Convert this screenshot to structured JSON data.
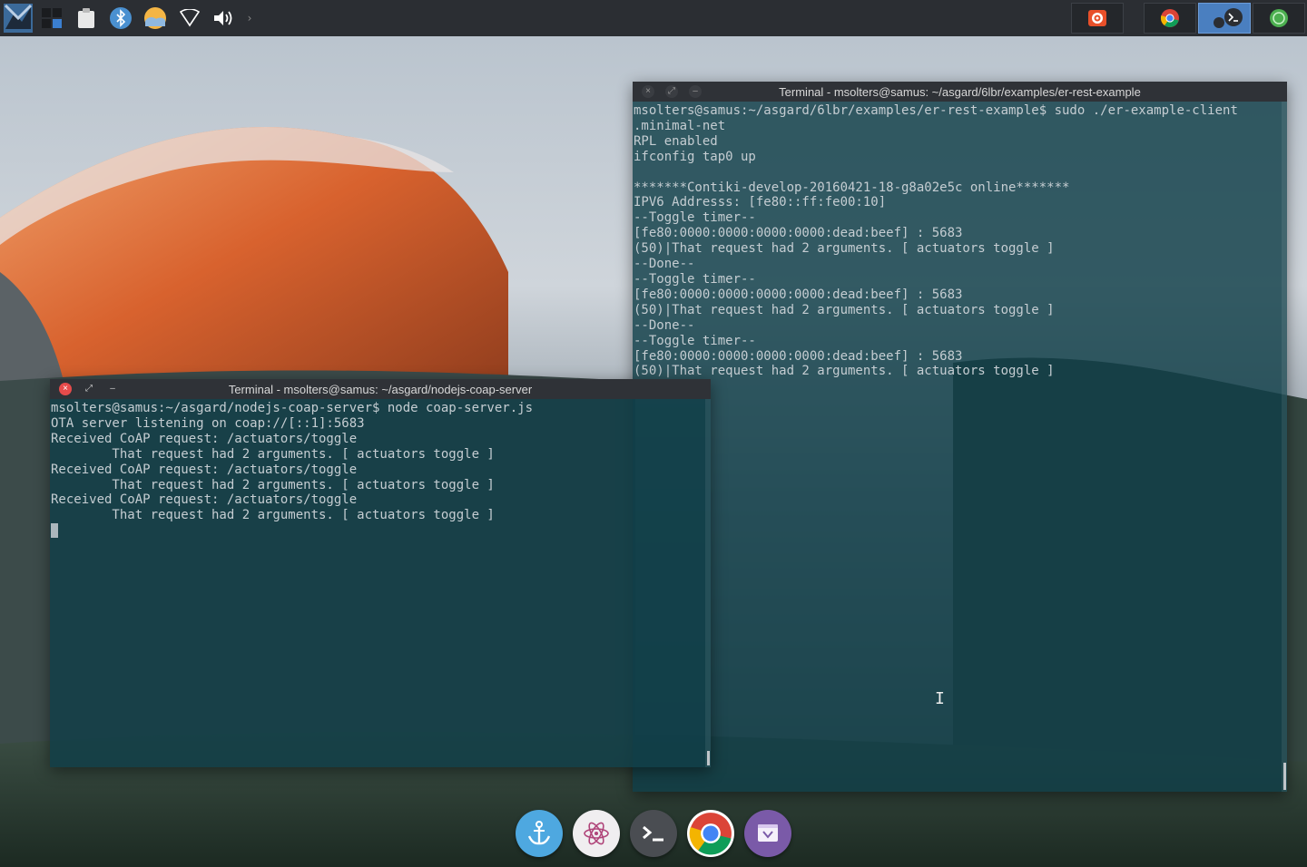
{
  "panel": {
    "tray_icons": [
      "app-launcher-icon",
      "workspace-switcher-icon",
      "clipboard-icon",
      "bluetooth-icon",
      "weather-icon",
      "wifi-icon",
      "volume-icon"
    ],
    "tasks": [
      {
        "icon": "camera-app-icon",
        "active": false
      },
      {
        "icon": "chrome-icon",
        "active": false
      },
      {
        "icon": "terminal-icon",
        "active": true
      },
      {
        "icon": "network-app-icon",
        "active": false
      }
    ]
  },
  "terminals": [
    {
      "title": "Terminal - msolters@samus: ~/asgard/6lbr/examples/er-rest-example",
      "lines": [
        "msolters@samus:~/asgard/6lbr/examples/er-rest-example$ sudo ./er-example-client",
        ".minimal-net",
        "RPL enabled",
        "ifconfig tap0 up",
        "",
        "*******Contiki-develop-20160421-18-g8a02e5c online*******",
        "IPV6 Addresss: [fe80::ff:fe00:10]",
        "--Toggle timer--",
        "[fe80:0000:0000:0000:0000:dead:beef] : 5683",
        "(50)|That request had 2 arguments. [ actuators toggle ]",
        "--Done--",
        "--Toggle timer--",
        "[fe80:0000:0000:0000:0000:dead:beef] : 5683",
        "(50)|That request had 2 arguments. [ actuators toggle ]",
        "--Done--",
        "--Toggle timer--",
        "[fe80:0000:0000:0000:0000:dead:beef] : 5683",
        "(50)|That request had 2 arguments. [ actuators toggle ]"
      ]
    },
    {
      "title": "Terminal - msolters@samus: ~/asgard/nodejs-coap-server",
      "lines": [
        "msolters@samus:~/asgard/nodejs-coap-server$ node coap-server.js",
        "OTA server listening on coap://[::1]:5683",
        "Received CoAP request: /actuators/toggle",
        "        That request had 2 arguments. [ actuators toggle ]",
        "Received CoAP request: /actuators/toggle",
        "        That request had 2 arguments. [ actuators toggle ]",
        "Received CoAP request: /actuators/toggle",
        "        That request had 2 arguments. [ actuators toggle ]"
      ]
    }
  ],
  "dock": {
    "items": [
      {
        "icon": "anchor-icon",
        "color": "#4ea8e0"
      },
      {
        "icon": "atom-icon",
        "color": "#f0eef0"
      },
      {
        "icon": "terminal-icon",
        "color": "#4a4d52"
      },
      {
        "icon": "chrome-icon",
        "color": "#ffffff"
      },
      {
        "icon": "nylas-mail-icon",
        "color": "#7a5aa8"
      }
    ]
  }
}
